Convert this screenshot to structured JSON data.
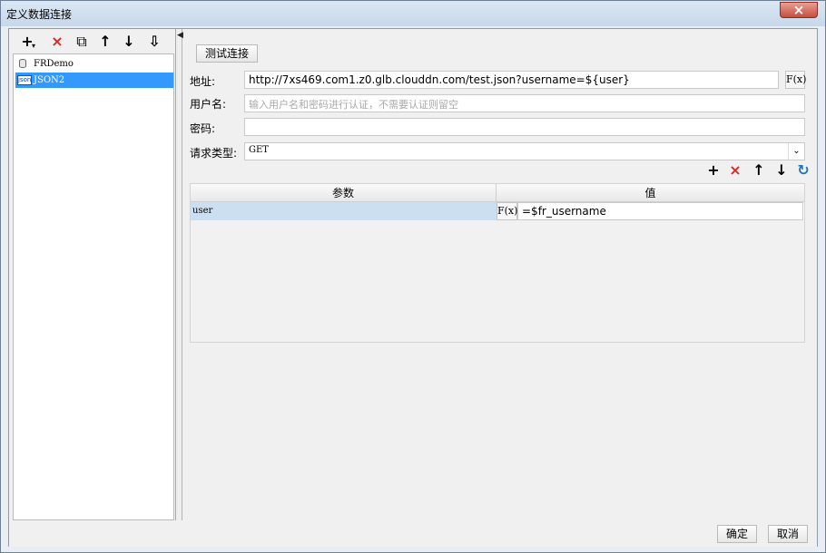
{
  "window": {
    "title": "定义数据连接",
    "close_label": "×"
  },
  "toolbar": {
    "add": "+",
    "add_menu": "▾",
    "delete": "×",
    "copy": "⧉",
    "move_up": "↑",
    "move_down": "↓",
    "sort": "⇩"
  },
  "splitter": {
    "collapse": "◀"
  },
  "tree": {
    "items": [
      {
        "label": "FRDemo",
        "icon": "database-icon"
      },
      {
        "label": "JSON2",
        "icon": "json-icon",
        "icon_text": "json",
        "selected": true
      }
    ]
  },
  "connection": {
    "test_button": "测试连接",
    "address_label": "地址:",
    "address_value": "http://7xs469.com1.z0.glb.clouddn.com/test.json?username=${user}",
    "formula_button": "F(x)",
    "username_label": "用户名:",
    "username_placeholder": "输入用户名和密码进行认证，不需要认证则留空",
    "password_label": "密码:",
    "password_value": "",
    "request_type_label": "请求类型:",
    "request_type_value": "GET",
    "dropdown_arrow": "⌄"
  },
  "params_toolbar": {
    "add": "+",
    "delete": "×",
    "up": "↑",
    "down": "↓",
    "refresh": "↻"
  },
  "params_table": {
    "columns": [
      "参数",
      "值"
    ],
    "rows": [
      {
        "param": "user",
        "formula_button": "F(x)",
        "value": "=$fr_username"
      }
    ]
  },
  "footer": {
    "ok": "确定",
    "cancel": "取消"
  },
  "colors": {
    "selection": "#3399ff",
    "delete_red": "#e02424",
    "refresh_blue": "#1e73be"
  }
}
